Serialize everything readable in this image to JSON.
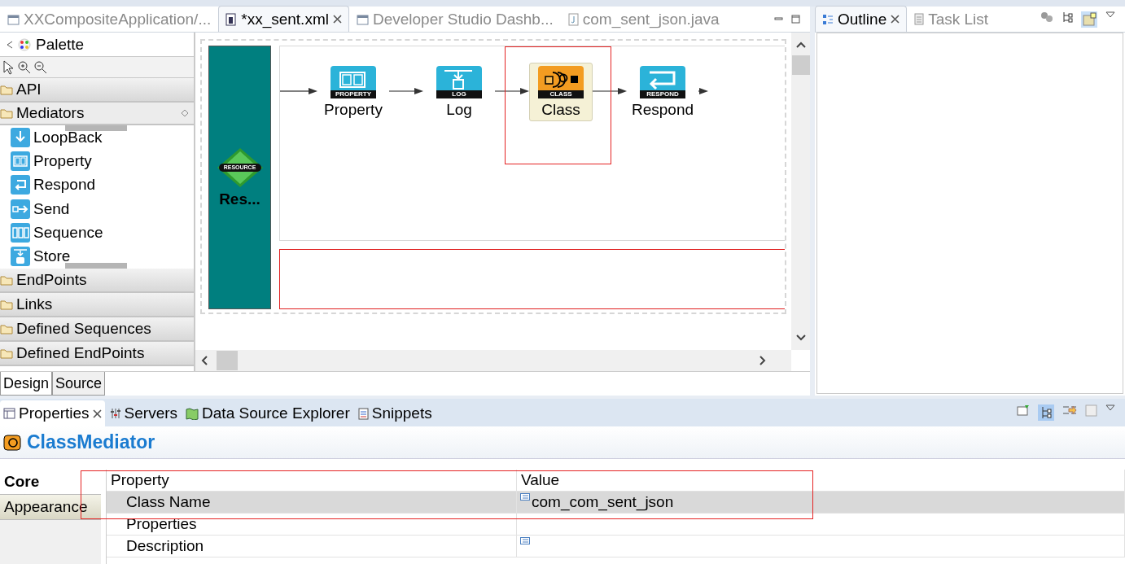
{
  "editor_tabs": [
    {
      "label": "XXCompositeApplication/...",
      "selected": false,
      "kind": "file"
    },
    {
      "label": "*xx_sent.xml",
      "selected": true,
      "kind": "xml"
    },
    {
      "label": "Developer Studio Dashb...",
      "selected": false,
      "kind": "file"
    },
    {
      "label": "com_sent_json.java",
      "selected": false,
      "kind": "java"
    }
  ],
  "palette": {
    "title": "Palette",
    "drawers": [
      {
        "label": "API",
        "expanded": false
      },
      {
        "label": "Mediators",
        "expanded": true,
        "items": [
          {
            "label": "LoopBack",
            "kind": "loopback"
          },
          {
            "label": "Property",
            "kind": "property"
          },
          {
            "label": "Respond",
            "kind": "respond"
          },
          {
            "label": "Send",
            "kind": "send"
          },
          {
            "label": "Sequence",
            "kind": "sequence"
          },
          {
            "label": "Store",
            "kind": "store"
          }
        ]
      },
      {
        "label": "EndPoints",
        "expanded": false
      },
      {
        "label": "Links",
        "expanded": false
      },
      {
        "label": "Defined Sequences",
        "expanded": false
      },
      {
        "label": "Defined EndPoints",
        "expanded": false
      }
    ]
  },
  "canvas": {
    "resource": {
      "badge": "RESOURCE",
      "label": "Res..."
    },
    "nodes": [
      {
        "label": "Property",
        "badge": "PROPERTY",
        "kind": "property",
        "selected": false
      },
      {
        "label": "Log",
        "badge": "LOG",
        "kind": "log",
        "selected": false
      },
      {
        "label": "Class",
        "badge": "CLASS",
        "kind": "class",
        "selected": true
      },
      {
        "label": "Respond",
        "badge": "RESPOND",
        "kind": "respond",
        "selected": false
      }
    ]
  },
  "editor_bottom_tabs": [
    {
      "label": "Design",
      "selected": true
    },
    {
      "label": "Source",
      "selected": false
    }
  ],
  "outline_tabs": [
    {
      "label": "Outline",
      "selected": true
    },
    {
      "label": "Task List",
      "selected": false
    }
  ],
  "bottom_tabs": [
    {
      "label": "Properties",
      "selected": true,
      "kind": "properties"
    },
    {
      "label": "Servers",
      "selected": false,
      "kind": "servers"
    },
    {
      "label": "Data Source Explorer",
      "selected": false,
      "kind": "datasource"
    },
    {
      "label": "Snippets",
      "selected": false,
      "kind": "snippets"
    }
  ],
  "properties": {
    "title": "ClassMediator",
    "side_tabs": [
      {
        "label": "Core",
        "selected": true
      },
      {
        "label": "Appearance",
        "selected": false
      }
    ],
    "columns": [
      "Property",
      "Value"
    ],
    "rows": [
      {
        "property": "Class Name",
        "value": "com_com_sent_json",
        "value_icon": true,
        "selected": true
      },
      {
        "property": "Properties",
        "value_icon": false,
        "selected": false
      },
      {
        "property": "Description",
        "value_icon": true,
        "selected": false
      }
    ]
  }
}
